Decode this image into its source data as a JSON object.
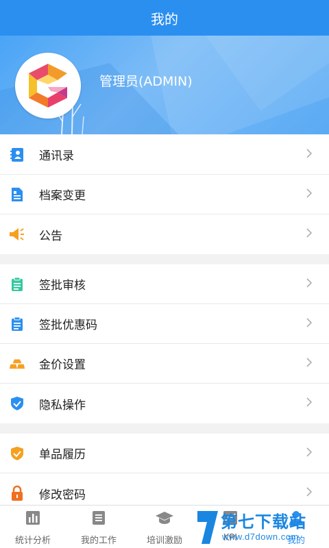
{
  "header": {
    "title": "我的"
  },
  "profile": {
    "name": "管理员(ADMIN)"
  },
  "groups": [
    {
      "items": [
        {
          "label": "通讯录",
          "icon": "contacts-icon",
          "color": "#2b8ff0"
        },
        {
          "label": "档案变更",
          "icon": "document-icon",
          "color": "#2b8ff0"
        },
        {
          "label": "公告",
          "icon": "megaphone-icon",
          "color": "#f5a020"
        }
      ]
    },
    {
      "items": [
        {
          "label": "签批审核",
          "icon": "clipboard-icon",
          "color": "#35c8a0"
        },
        {
          "label": "签批优惠码",
          "icon": "clipboard-icon",
          "color": "#2b8ff0"
        },
        {
          "label": "金价设置",
          "icon": "gold-bars-icon",
          "color": "#f5a020"
        },
        {
          "label": "隐私操作",
          "icon": "shield-check-icon",
          "color": "#2b8ff0"
        }
      ]
    },
    {
      "items": [
        {
          "label": "单品履历",
          "icon": "shield-check-icon",
          "color": "#f5a020"
        },
        {
          "label": "修改密码",
          "icon": "lock-icon",
          "color": "#f07020"
        }
      ]
    }
  ],
  "tabbar": {
    "tabs": [
      {
        "label": "统计分析",
        "icon": "bar-chart-icon"
      },
      {
        "label": "我的工作",
        "icon": "list-icon"
      },
      {
        "label": "培训激励",
        "icon": "graduation-cap-icon"
      },
      {
        "label": "KPI",
        "icon": "line-chart-icon"
      },
      {
        "label": "我的",
        "icon": "person-icon",
        "active": true
      }
    ]
  },
  "watermark": {
    "text": "第七下载站",
    "url": "www.d7down.com"
  },
  "colors": {
    "primary": "#2b8ff0",
    "accent": "#f5a020"
  }
}
